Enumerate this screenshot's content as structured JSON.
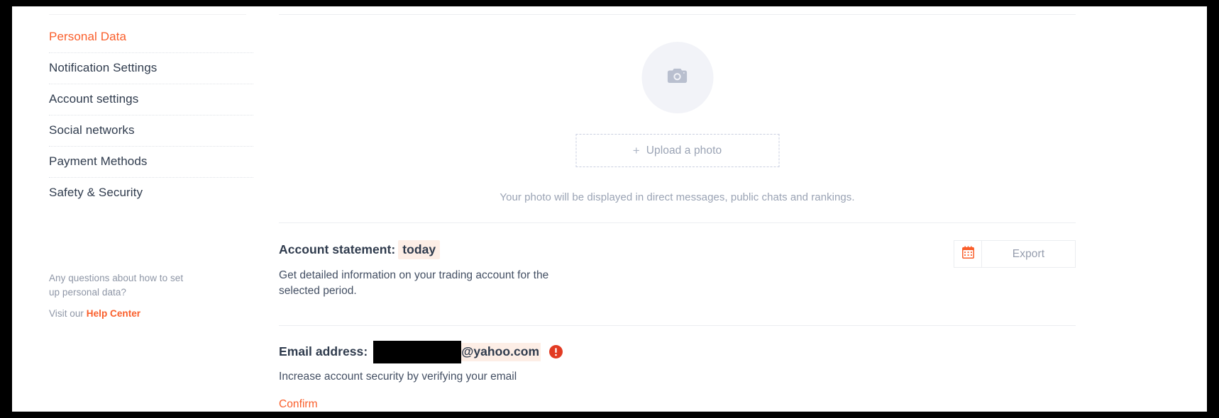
{
  "colors": {
    "accent": "#fa5e2a",
    "text_dark": "#2f3b4d",
    "text_muted": "#9aa3b4",
    "highlight_bg": "#fdeee6",
    "warning_red": "#e23a22",
    "avatar_bg": "#f2f3f8"
  },
  "sidebar": {
    "items": [
      {
        "label": "Personal Data",
        "active": true
      },
      {
        "label": "Notification Settings",
        "active": false
      },
      {
        "label": "Account settings",
        "active": false
      },
      {
        "label": "Social networks",
        "active": false
      },
      {
        "label": "Payment Methods",
        "active": false
      },
      {
        "label": "Safety & Security",
        "active": false
      }
    ],
    "help": {
      "question_line1": "Any questions about how to set",
      "question_line2": "up personal data?",
      "visit_prefix": "Visit our ",
      "visit_link": "Help Center"
    }
  },
  "photo": {
    "avatar_icon": "camera-icon",
    "upload_plus": "+",
    "upload_label": "Upload a photo",
    "caption": "Your photo will be displayed in direct messages, public chats and rankings."
  },
  "statement": {
    "title_label": "Account statement:",
    "period_value": "today",
    "description_line1": "Get detailed information on your trading account for the",
    "description_line2": "selected period.",
    "calendar_icon": "calendar-icon",
    "export_label": "Export"
  },
  "email": {
    "label": "Email address:",
    "redacted_value": "",
    "domain": "@yahoo.com",
    "warning_icon": "alert-circle-icon",
    "subtext": "Increase account security by verifying your email",
    "confirm_label": "Confirm"
  }
}
